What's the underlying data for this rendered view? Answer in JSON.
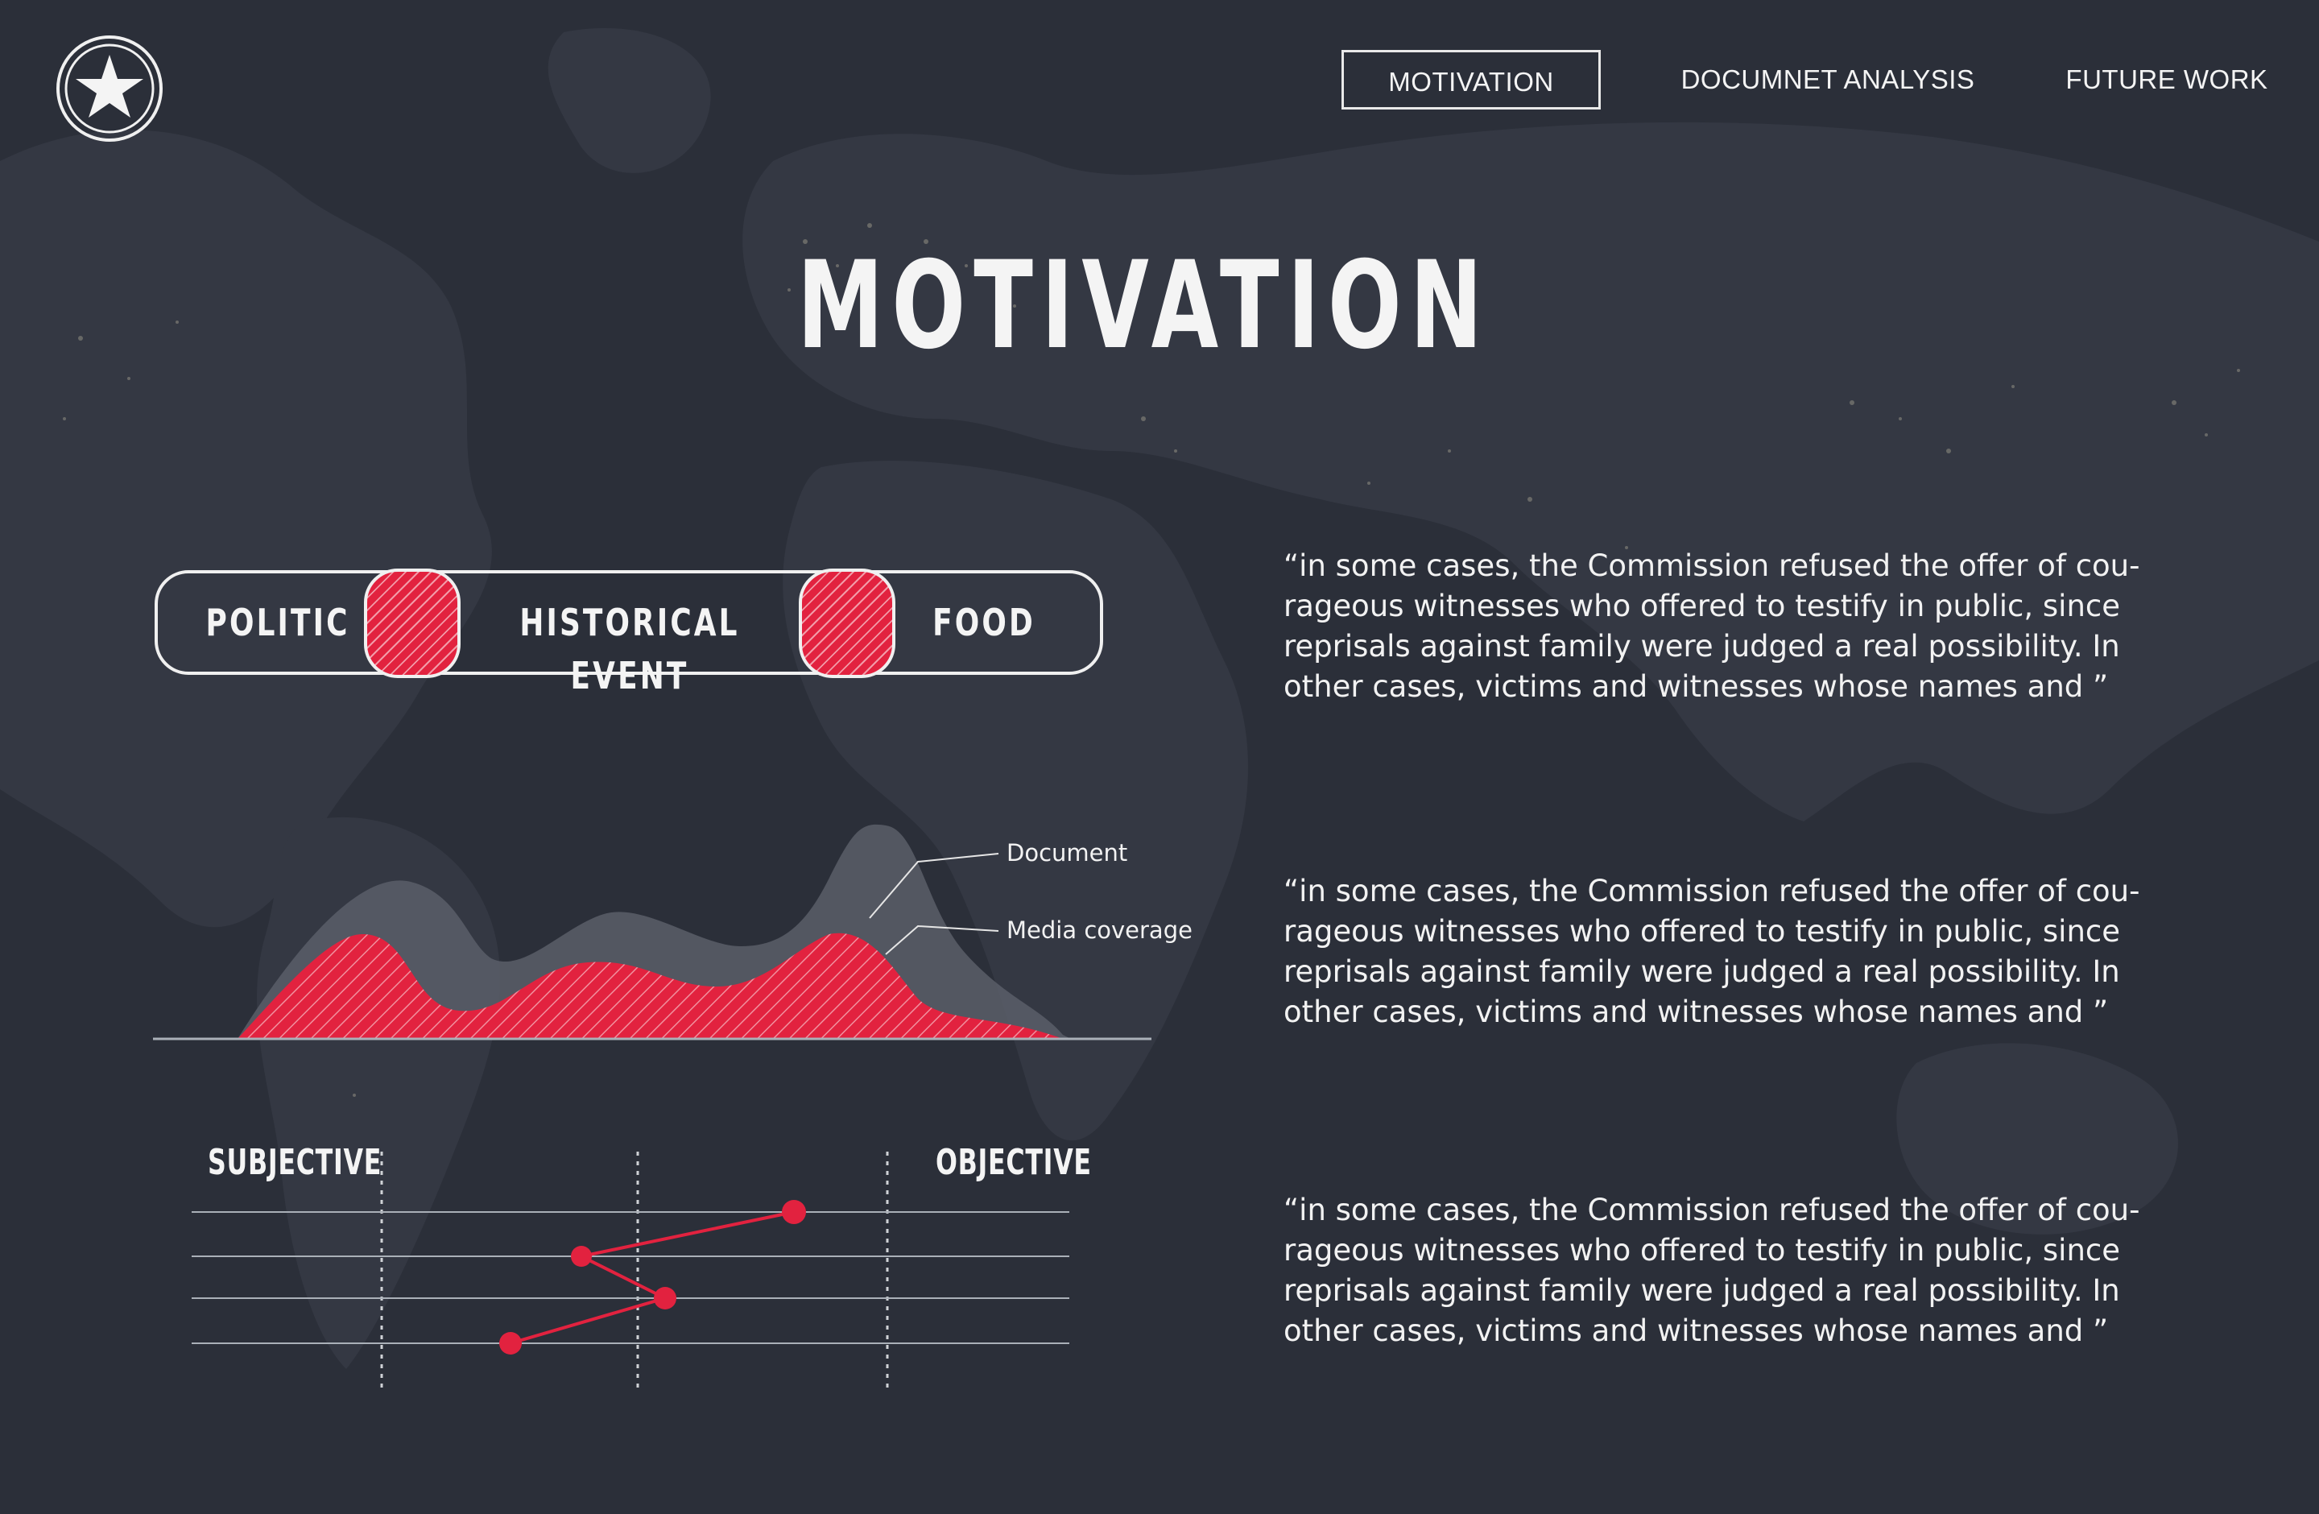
{
  "nav": {
    "items": [
      {
        "label": "MOTIVATION",
        "active": true
      },
      {
        "label": "DOCUMNET ANALYSIS",
        "active": false
      },
      {
        "label": "FUTURE WORK",
        "active": false
      }
    ]
  },
  "logo": {
    "icon": "star-icon"
  },
  "page_title": "MOTIVATION",
  "category_toggle": {
    "labels": [
      "POLITIC",
      "HISTORICAL EVENT",
      "FOOD"
    ]
  },
  "quotes": [
    {
      "lines": [
        "“in some cases, the Commission refused the offer of cou-",
        "rageous witnesses who offered to testify in public, since",
        "reprisals against family were judged a real possibility. In",
        "other cases, victims and witnesses whose names and ”"
      ]
    },
    {
      "lines": [
        "“in some cases, the Commission refused the offer of cou-",
        "rageous witnesses who offered to testify in public, since",
        "reprisals against family were judged a real possibility. In",
        "other cases, victims and witnesses whose names and ”"
      ]
    },
    {
      "lines": [
        "“in some cases, the Commission refused the offer of cou-",
        "rageous witnesses who offered to testify in public, since",
        "reprisals against family were judged a real possibility. In",
        "other cases, victims and witnesses whose names and ”"
      ]
    }
  ],
  "area_chart": {
    "legend": [
      "Document",
      "Media coverage"
    ],
    "colors": {
      "document": "#5a5e68",
      "media": "#e2223f"
    }
  },
  "scale_chart": {
    "left_label": "SUBJECTIVE",
    "right_label": "OBJECTIVE",
    "color": "#e2223f"
  }
}
